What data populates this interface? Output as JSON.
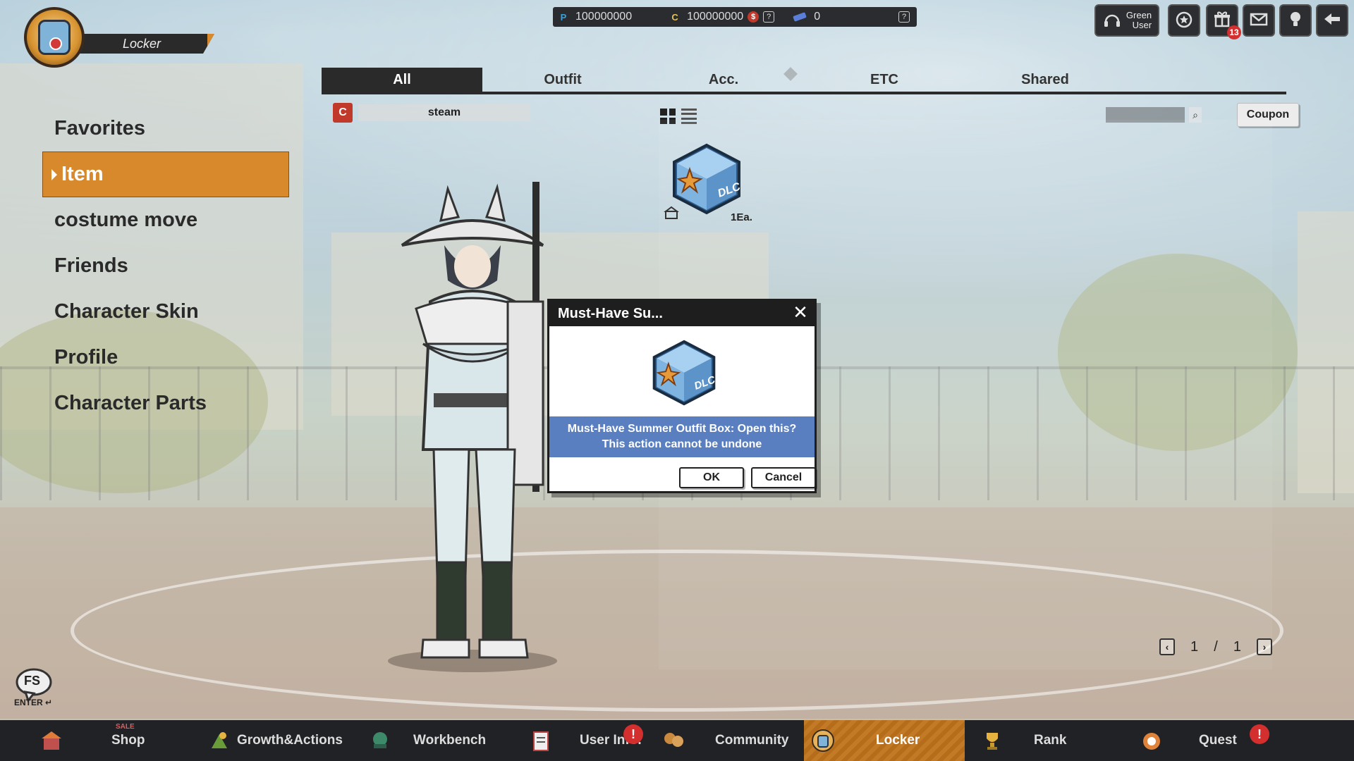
{
  "header": {
    "title": "Locker",
    "currencies": [
      {
        "icon": "P",
        "color": "#3aa0d8",
        "value": "100000000"
      },
      {
        "icon": "C",
        "color": "#e6c44a",
        "value": "100000000"
      },
      {
        "icon": "ticket",
        "color": "#5b7fd8",
        "value": "0"
      }
    ],
    "dollar_badge": "$",
    "help_label": "?",
    "user_button": {
      "line1": "Green",
      "line2": "User"
    },
    "gift_count": "13"
  },
  "tabs": [
    {
      "label": "All",
      "active": true
    },
    {
      "label": "Outfit",
      "active": false
    },
    {
      "label": "Acc.",
      "active": false
    },
    {
      "label": "ETC",
      "active": false
    },
    {
      "label": "Shared",
      "active": false
    }
  ],
  "filter": {
    "badge": "C",
    "value": "steam"
  },
  "coupon_label": "Coupon",
  "search_icon": "⌕",
  "sidebar": {
    "items": [
      {
        "label": "Favorites",
        "active": false
      },
      {
        "label": "Item",
        "active": true
      },
      {
        "label": "costume move",
        "active": false
      },
      {
        "label": "Friends",
        "active": false
      },
      {
        "label": "Character Skin",
        "active": false
      },
      {
        "label": "Profile",
        "active": false
      },
      {
        "label": "Character Parts",
        "active": false
      }
    ]
  },
  "inventory": {
    "items": [
      {
        "name": "Must-Have Summer Outfit Box",
        "icon": "dlc-box-icon",
        "quantity": "1Ea."
      }
    ]
  },
  "pagination": {
    "current": "1",
    "separator": "/",
    "total": "1",
    "prev": "‹",
    "next": "›"
  },
  "chat": {
    "label": "FS",
    "enter": "ENTER ↵"
  },
  "bottom_nav": [
    {
      "label": "Shop",
      "sale": "SALE",
      "active": false
    },
    {
      "label": "Growth&Actions",
      "active": false
    },
    {
      "label": "Workbench",
      "active": false
    },
    {
      "label": "User Info.",
      "alert": "!",
      "active": false
    },
    {
      "label": "Community",
      "active": false
    },
    {
      "label": "Locker",
      "active": true
    },
    {
      "label": "Rank",
      "active": false
    },
    {
      "label": "Quest",
      "alert": "!",
      "active": false
    }
  ],
  "modal": {
    "title": "Must-Have Su...",
    "close": "✕",
    "line1": "Must-Have Summer Outfit Box: Open this?",
    "line2": "This action cannot be undone",
    "ok": "OK",
    "cancel": "Cancel"
  },
  "colors": {
    "accent": "#d7892b",
    "modal_msg": "#5a7fc0",
    "nav_bg": "#202225"
  }
}
